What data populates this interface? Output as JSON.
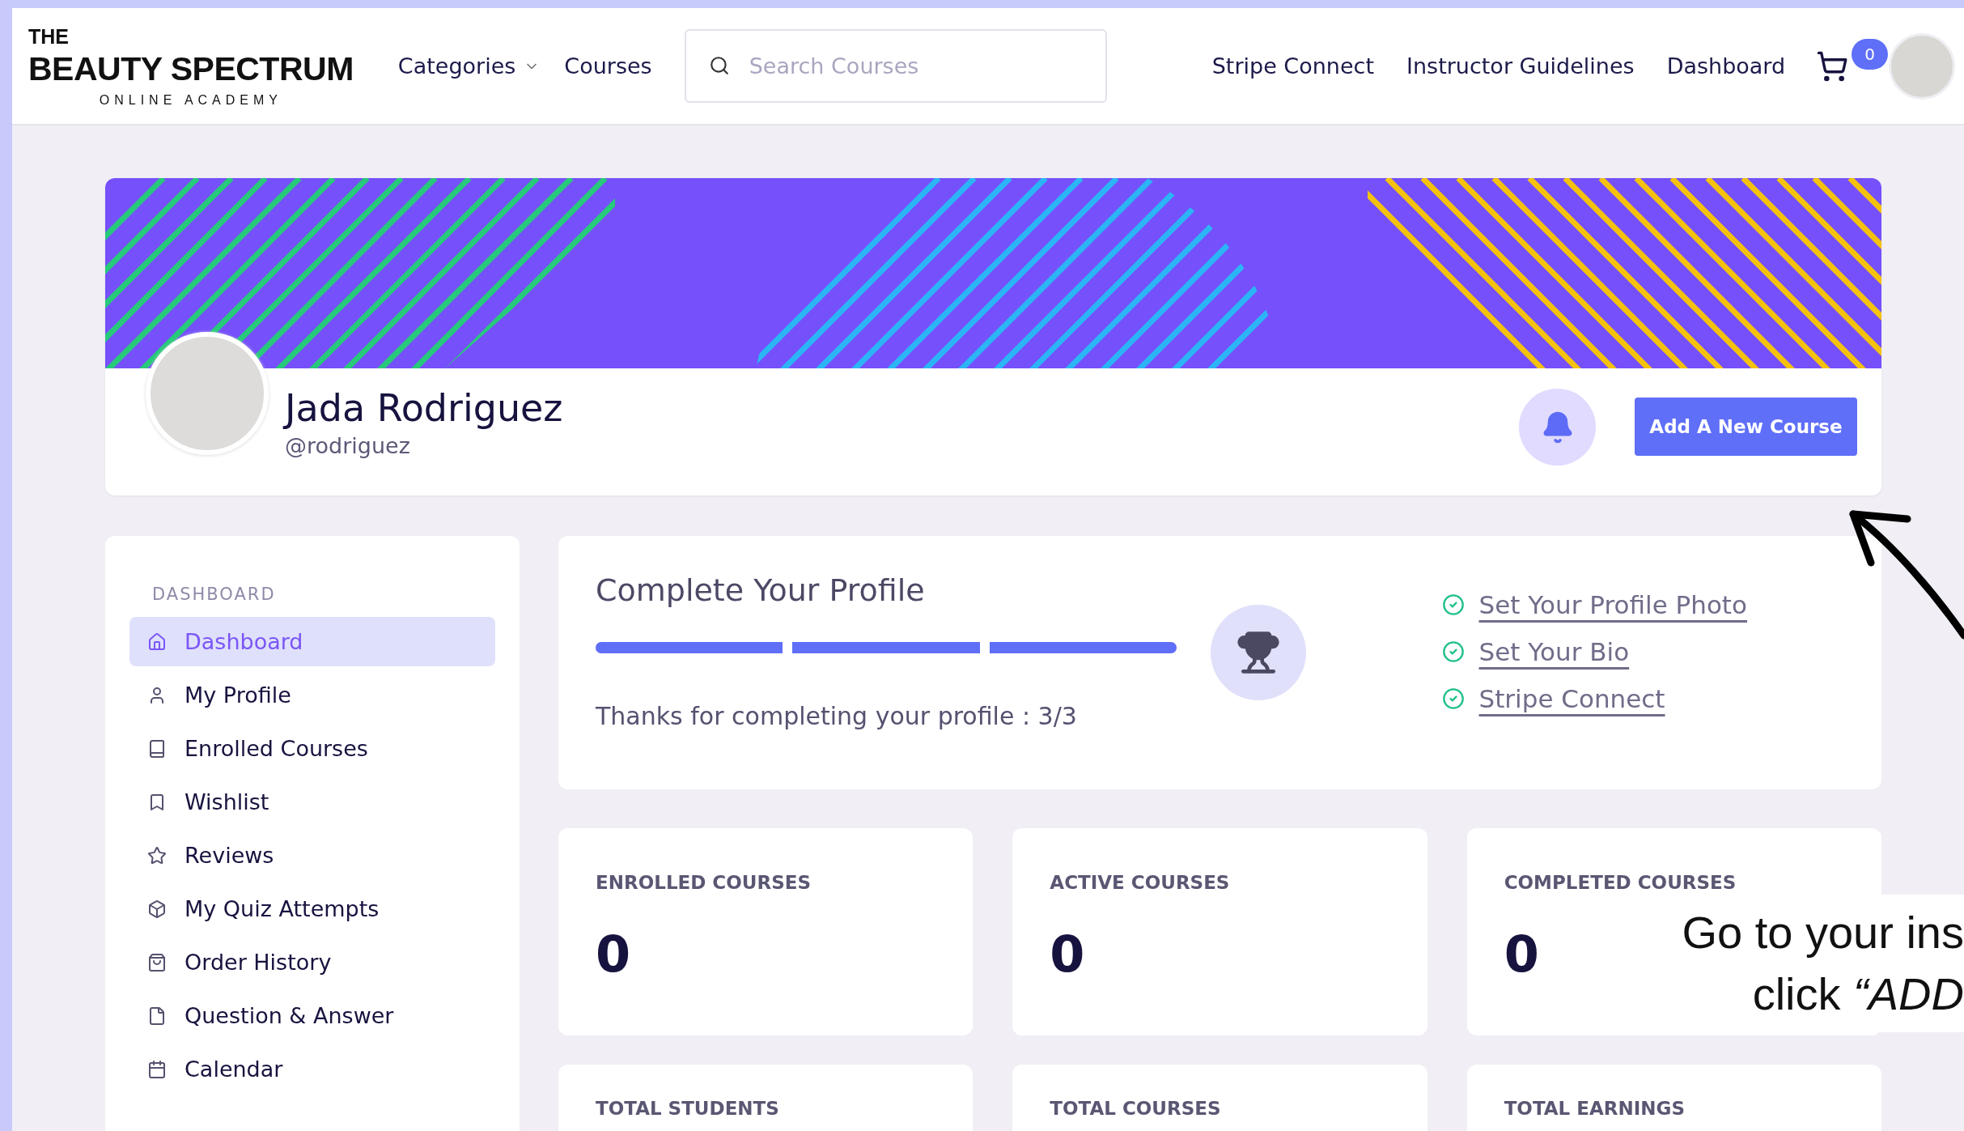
{
  "header": {
    "logo": {
      "line_1": "THE",
      "line_2": "BEAUTY SPECTRUM",
      "line_3": "ONLINE ACADEMY"
    },
    "nav_left": [
      {
        "label": "Categories",
        "kind": "dropdown"
      },
      {
        "label": "Courses",
        "kind": "link"
      }
    ],
    "search": {
      "placeholder": "Search Courses"
    },
    "nav_right": [
      "Stripe Connect",
      "Instructor Guidelines",
      "Dashboard"
    ],
    "cart_count": "0"
  },
  "profile": {
    "name": "Jada Rodriguez",
    "handle": "@rodriguez",
    "button": "Add A New Course"
  },
  "sidebar": {
    "heading": "DASHBOARD",
    "items": [
      {
        "label": "Dashboard",
        "selected": true
      },
      {
        "label": "My Profile",
        "selected": false
      },
      {
        "label": "Enrolled Courses",
        "selected": false
      },
      {
        "label": "Wishlist",
        "selected": false
      },
      {
        "label": "Reviews",
        "selected": false
      },
      {
        "label": "My Quiz Attempts",
        "selected": false
      },
      {
        "label": "Order History",
        "selected": false
      },
      {
        "label": "Question & Answer",
        "selected": false
      },
      {
        "label": "Calendar",
        "selected": false
      }
    ]
  },
  "complete_profile": {
    "title": "Complete Your Profile",
    "progress": {
      "level": 1
    },
    "message": "Thanks for completing your profile :",
    "count": "3/3",
    "steps": [
      {
        "label": "Set Your Profile Photo",
        "done": true
      },
      {
        "label": "Set Your Bio",
        "done": true
      },
      {
        "label": "Stripe Connect",
        "done": true
      }
    ]
  },
  "stats": [
    {
      "label": "ENROLLED COURSES",
      "value": "0"
    },
    {
      "label": "ACTIVE COURSES",
      "value": "0"
    },
    {
      "label": "COMPLETED COURSES",
      "value": "0"
    },
    {
      "label": "TOTAL STUDENTS"
    },
    {
      "label": "TOTAL COURSES"
    },
    {
      "label": "TOTAL EARNINGS"
    }
  ],
  "annotation": {
    "lines": [
      "Go to your ins",
      "click *“ADD*"
    ]
  }
}
